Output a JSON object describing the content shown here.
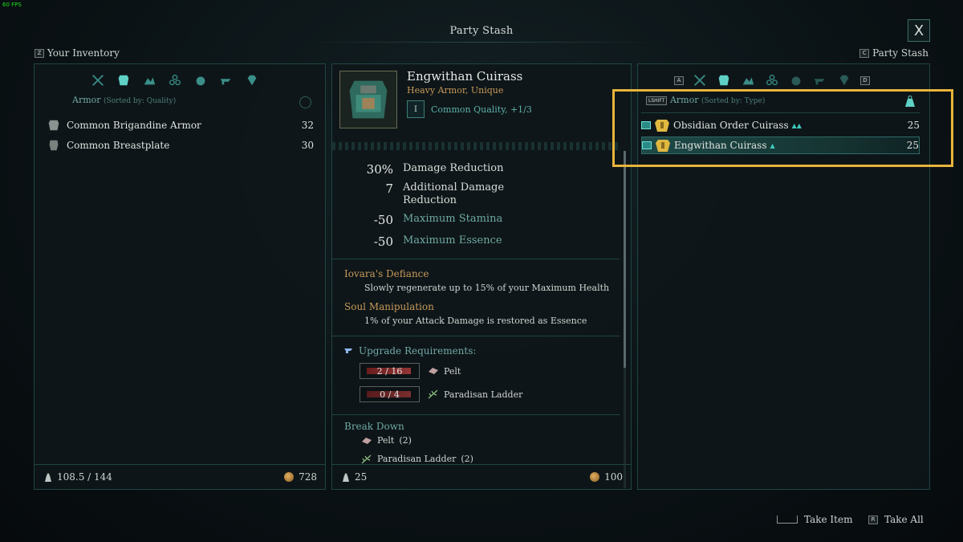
{
  "fps": "60 FPS",
  "title": "Party Stash",
  "close": "X",
  "left_header": {
    "key": "Z",
    "label": "Your Inventory"
  },
  "right_header": {
    "key": "C",
    "label": "Party Stash"
  },
  "inventory": {
    "category": "Armor",
    "sort": "(Sorted by: Quality)",
    "items": [
      {
        "name": "Common Brigandine Armor",
        "qty": "32",
        "icon": "armor-icon"
      },
      {
        "name": "Common Breastplate",
        "qty": "30",
        "icon": "breastplate-icon"
      }
    ],
    "weight": "108.5 / 144",
    "coins": "728"
  },
  "detail": {
    "name": "Engwithan Cuirass",
    "type": "Heavy Armor, Unique",
    "tier": "I",
    "quality": "Common Quality, +1/3",
    "stats": [
      {
        "value": "30%",
        "label": "Damage Reduction"
      },
      {
        "value": "7",
        "label": "Additional Damage Reduction"
      },
      {
        "value": "-50",
        "label": "Maximum Stamina"
      },
      {
        "value": "-50",
        "label": "Maximum Essence"
      }
    ],
    "perks": [
      {
        "title": "Iovara's Defiance",
        "desc": "Slowly regenerate up to 15% of your Maximum Health"
      },
      {
        "title": "Soul Manipulation",
        "desc": "1% of your Attack Damage is restored as Essence"
      }
    ],
    "upgrade_title": "Upgrade Requirements:",
    "requirements": [
      {
        "count": "2 / 16",
        "name": "Pelt",
        "fill": 0.125
      },
      {
        "count": "0 / 4",
        "name": "Paradisan Ladder",
        "fill": 0.0
      }
    ],
    "breakdown_title": "Break Down",
    "breakdown": [
      {
        "name": "Pelt",
        "count": "(2)"
      },
      {
        "name": "Paradisan Ladder",
        "count": "(2)"
      }
    ],
    "weight": "25",
    "value": "100"
  },
  "stash": {
    "key_a": "A",
    "key_d": "D",
    "key_shift": "LSHIFT",
    "category": "Armor",
    "sort": "(Sorted by: Type)",
    "items": [
      {
        "name": "Obsidian Order Cuirass",
        "qty": "25"
      },
      {
        "name": "Engwithan Cuirass",
        "qty": "25"
      }
    ]
  },
  "actions": {
    "take_item": "Take Item",
    "take_all_key": "R",
    "take_all": "Take All"
  },
  "colors": {
    "accent": "#6fa9a3",
    "gold": "#c89a5a",
    "highlight": "#e8b43a"
  }
}
